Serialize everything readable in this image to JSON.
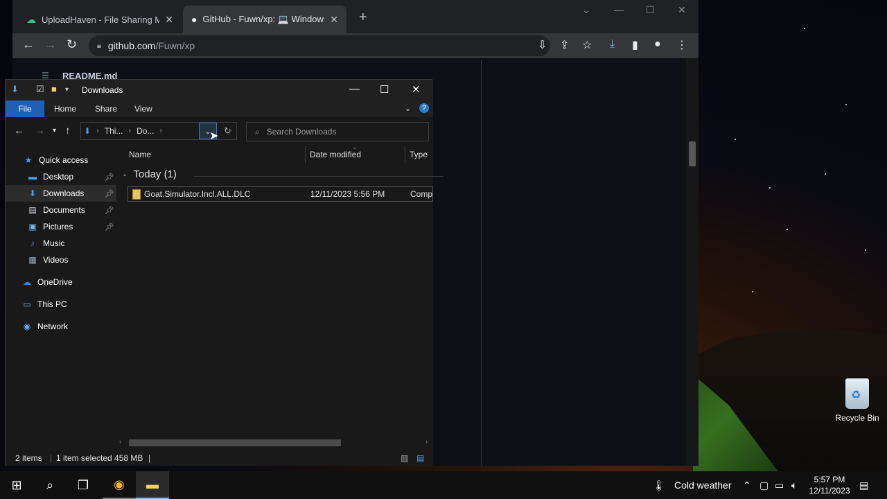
{
  "browser": {
    "tabs": [
      {
        "title": "UploadHaven - File Sharing Made",
        "active": false
      },
      {
        "title": "GitHub - Fuwn/xp: 💻 Windows",
        "active": true
      }
    ],
    "new_tab": "+",
    "url_host": "github.com",
    "url_path": "/Fuwn/xp",
    "page_heading": "README.md"
  },
  "explorer": {
    "title": "Downloads",
    "ribbon": {
      "file": "File",
      "home": "Home",
      "share": "Share",
      "view": "View"
    },
    "address": {
      "crumb1": "Thi...",
      "crumb2": "Do..."
    },
    "search_placeholder": "Search Downloads",
    "nav": [
      {
        "label": "Quick access"
      },
      {
        "label": "Desktop"
      },
      {
        "label": "Downloads"
      },
      {
        "label": "Documents"
      },
      {
        "label": "Pictures"
      },
      {
        "label": "Music"
      },
      {
        "label": "Videos"
      },
      {
        "label": "OneDrive"
      },
      {
        "label": "This PC"
      },
      {
        "label": "Network"
      }
    ],
    "columns": {
      "name": "Name",
      "date": "Date modified",
      "type": "Type"
    },
    "group": "Today (1)",
    "file": {
      "name": "Goat.Simulator.Incl.ALL.DLC",
      "date": "12/11/2023 5:56 PM",
      "type": "Comp"
    },
    "status": {
      "count": "2 items",
      "selected": "1 item selected  458 MB"
    }
  },
  "desktop": {
    "recycle_bin": "Recycle Bin"
  },
  "taskbar": {
    "weather": "Cold weather",
    "time": "5:57 PM",
    "date": "12/11/2023"
  }
}
